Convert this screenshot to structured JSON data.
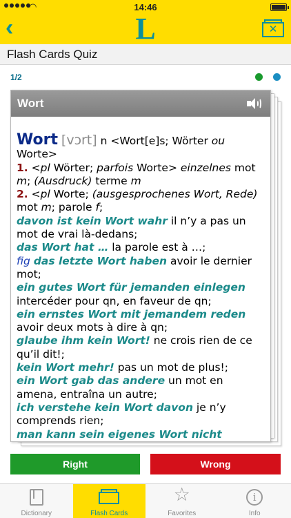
{
  "status": {
    "time": "14:46"
  },
  "nav": {
    "logo": "L",
    "close_glyph": "✕"
  },
  "page": {
    "title": "Flash Cards Quiz",
    "progress": "1/2"
  },
  "card": {
    "word": "Wort",
    "lemma": "Wort",
    "ipa": "[vɔrt]",
    "l1_gram": " n <Wort[e]s; Wörter ",
    "l1_ou": "ou",
    "l1_end": " Worte>",
    "num1": "1.",
    "s1a": " <",
    "s1_pl": "pl",
    "s1b": " Wörter; ",
    "s1_parfois": "parfois",
    "s1c": " Worte> ",
    "s1_einz": "einzelnes",
    "s1d": " mot ",
    "s1_m": "m",
    "s1e": "; ",
    "s1_ausdr": "(Ausdruck)",
    "s1f": " terme ",
    "s1_m2": "m",
    "num2": "2.",
    "s2a": " <",
    "s2_pl": "pl",
    "s2b": " Worte; ",
    "s2_ausg": "(ausgesprochenes Wort, Rede)",
    "s2c": " mot ",
    "s2_m": "m",
    "s2d": "; parole ",
    "s2_f": "f",
    "s2e": ";",
    "ex1": "davon ist kein Wort wahr",
    "tr1": " il n’y a pas un mot de vrai là-dedans;",
    "ex2": "das Wort hat …",
    "tr2": " la parole est à …;",
    "fig": "fig",
    "ex3": "das letzte Wort haben",
    "tr3": " avoir le dernier mot;",
    "ex4": "ein gutes Wort für jemanden einlegen",
    "tr4": " intercéder pour qn, en faveur de qn;",
    "ex5": "ein ernstes Wort mit jemandem reden",
    "tr5": " avoir deux mots à dire à qn;",
    "ex6": "glaube ihm kein Wort!",
    "tr6": " ne crois rien de ce qu’il dit!;",
    "ex7": "kein Wort mehr!",
    "tr7": " pas un mot de plus!;",
    "ex8": "ein Wort gab das andere",
    "tr8": " un mot en amena, entraîna un autre;",
    "ex9": "ich verstehe kein Wort davon",
    "tr9": " je n’y comprends rien;",
    "ex10": "man kann sein eigenes Wort nicht"
  },
  "buttons": {
    "right": "Right",
    "wrong": "Wrong"
  },
  "tabs": [
    {
      "label": "Dictionary",
      "icon": "book-icon"
    },
    {
      "label": "Flash Cards",
      "icon": "flash-cards-icon"
    },
    {
      "label": "Favorites",
      "icon": "star-icon"
    },
    {
      "label": "Info",
      "icon": "info-icon"
    }
  ],
  "colors": {
    "brand_yellow": "#ffdd00",
    "teal": "#0a8f9c",
    "right_green": "#1f9a2a",
    "wrong_red": "#d4101a"
  }
}
